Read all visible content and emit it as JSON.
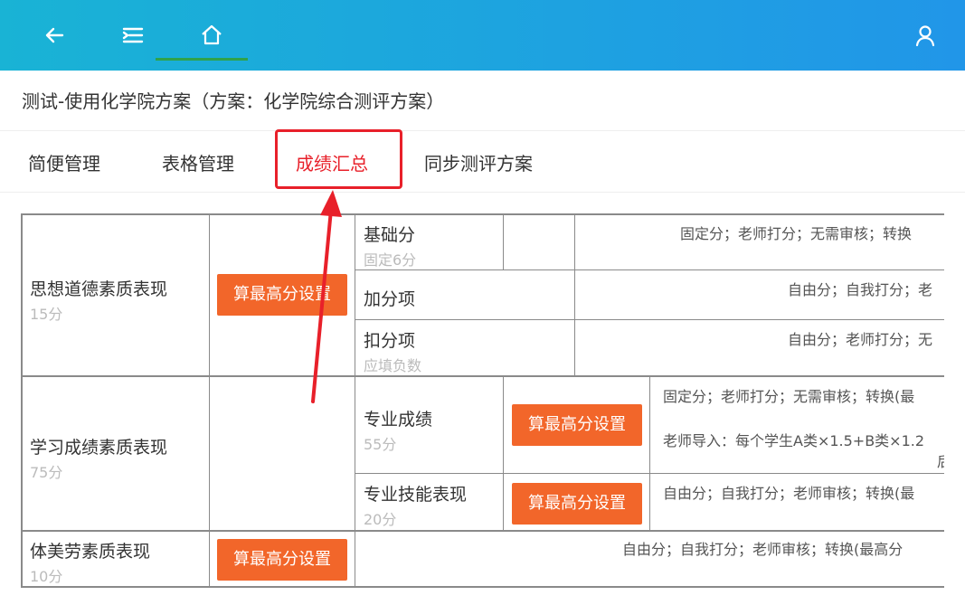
{
  "header": {
    "back_icon": "arrow-left-icon",
    "menu_icon": "menu-indent-icon",
    "home_icon": "home-icon",
    "user_icon": "user-icon",
    "bg_start": "#19b3d5",
    "bg_end": "#2196e8"
  },
  "page_title": "测试-使用化学院方案（方案：化学院综合测评方案）",
  "tabs": [
    {
      "label": "简便管理"
    },
    {
      "label": "表格管理"
    },
    {
      "label": "成绩汇总"
    },
    {
      "label": "同步测评方案"
    }
  ],
  "colors": {
    "active_tab": "#2fa24b",
    "highlight": "#e8202a",
    "button": "#f2662a"
  },
  "button_label": "算最高分设置",
  "table": {
    "sections": [
      {
        "name": "思想道德素质表现",
        "score": "15分"
      },
      {
        "name": "学习成绩素质表现",
        "score": "75分"
      },
      {
        "name": "体美劳素质表现",
        "score": "10分"
      }
    ],
    "items": [
      {
        "name": "基础分",
        "sub": "固定6分",
        "rule": "固定分；老师打分；无需审核；转换"
      },
      {
        "name": "加分项",
        "sub": "",
        "rule": "自由分；自我打分；老"
      },
      {
        "name": "扣分项",
        "sub": "应填负数",
        "rule": "自由分；老师打分；无"
      },
      {
        "name": "专业成绩",
        "sub": "55分",
        "rule": "固定分；老师打分；无需审核；转换(最",
        "rule2": "老师导入：每个学生A类×1.5+B类×1.2",
        "rule3": "后"
      },
      {
        "name": "专业技能表现",
        "sub": "20分",
        "rule": "自由分；自我打分；老师审核；转换(最"
      }
    ],
    "pe_rule": "自由分；自我打分；老师审核；转换(最高分"
  }
}
